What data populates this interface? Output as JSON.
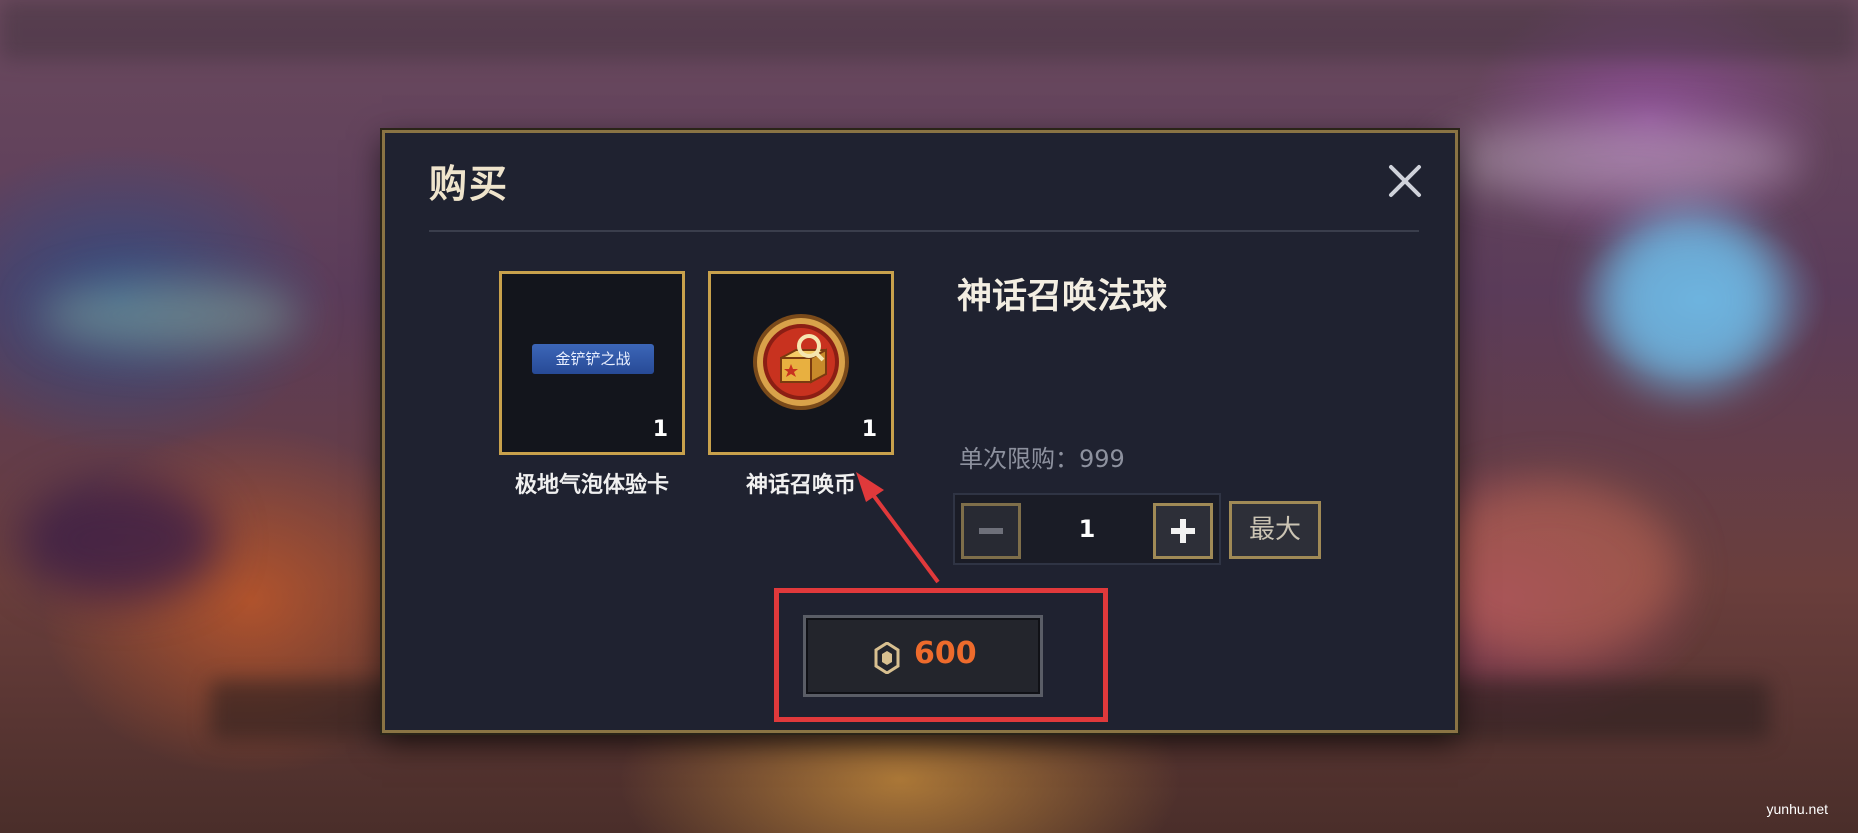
{
  "dialog": {
    "title": "购买",
    "close_icon": "close-icon"
  },
  "items": [
    {
      "name": "极地气泡体验卡",
      "qty": "1",
      "banner_text": "金铲铲之战",
      "icon": "experience-card-banner"
    },
    {
      "name": "神话召唤币",
      "qty": "1",
      "icon": "summon-coin-icon"
    }
  ],
  "product": {
    "name": "神话召唤法球",
    "limit_label": "单次限购：999"
  },
  "stepper": {
    "value": "1",
    "minus_icon": "minus-icon",
    "plus_icon": "plus-icon",
    "max_label": "最大"
  },
  "buy": {
    "price": "600",
    "currency_icon": "currency-icon"
  },
  "annotation": {
    "color": "#e0393b"
  },
  "watermark": "yunhu.net",
  "colors": {
    "gold_border": "#c8a14c",
    "dialog_bg": "#1f2230",
    "price": "#ee6b2c"
  }
}
